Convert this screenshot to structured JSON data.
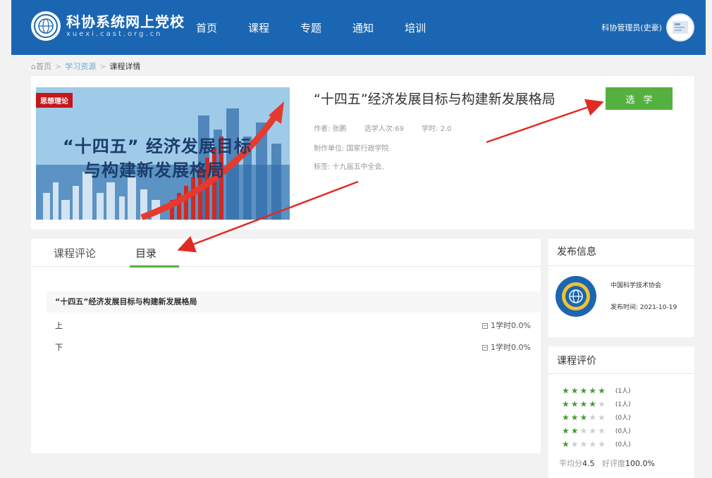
{
  "header": {
    "site_title": "科协系统网上党校",
    "site_sub": "xuexi.cast.org.cn",
    "nav": [
      {
        "label": "首页"
      },
      {
        "label": "课程"
      },
      {
        "label": "专题"
      },
      {
        "label": "通知"
      },
      {
        "label": "培训"
      }
    ],
    "user_name": "科协管理员(史豪)"
  },
  "breadcrumb": {
    "home": "首页",
    "sep1": ">",
    "level1": "学习资源",
    "sep2": ">",
    "current": "课程详情"
  },
  "course": {
    "cover_tag": "思想理论",
    "cover_line1": "“十四五” 经济发展目标",
    "cover_line2": "与构建新发展格局",
    "title": "“十四五”经济发展目标与构建新发展格局",
    "author": "作者: 张鹏",
    "enrolled": "选学人次:69",
    "hours": "学时: 2.0",
    "producer": "制作单位: 国家行政学院",
    "tags": "标签: 十九届五中全会,",
    "select_button": "选学"
  },
  "tabs": {
    "comments": "课程评论",
    "catalog": "目录"
  },
  "catalog": {
    "heading": "“十四五”经济发展目标与构建新发展格局",
    "items": [
      {
        "label": "上",
        "status": "1学时0.0%"
      },
      {
        "label": "下",
        "status": "1学时0.0%"
      }
    ]
  },
  "publish": {
    "heading": "发布信息",
    "org": "中国科学技术协会",
    "time": "发布时间: 2021-10-19"
  },
  "rating": {
    "heading": "课程评价",
    "rows": [
      {
        "stars": 5,
        "count": "(1人)"
      },
      {
        "stars": 4,
        "count": "(1人)"
      },
      {
        "stars": 3,
        "count": "(0人)"
      },
      {
        "stars": 2,
        "count": "(0人)"
      },
      {
        "stars": 1,
        "count": "(0人)"
      }
    ],
    "avg_label": "平均分",
    "avg_value": "4.5",
    "good_label": "好评度",
    "good_value": "100.0%"
  },
  "colors": {
    "header_blue": "#1b66b2",
    "accent_green": "#55b13f",
    "arrow_red": "#e02b24"
  }
}
